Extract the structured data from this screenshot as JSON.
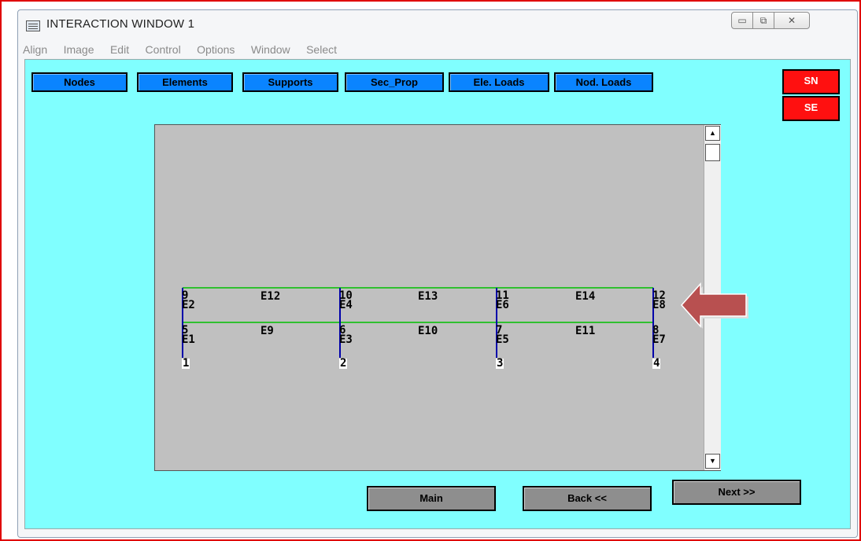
{
  "window": {
    "title": "INTERACTION WINDOW 1",
    "controls": {
      "minimize": "▭",
      "maximize": "⧉",
      "close": "✕"
    }
  },
  "menu": [
    "Align",
    "Image",
    "Edit",
    "Control",
    "Options",
    "Window",
    "Select"
  ],
  "toolbar": [
    "Nodes",
    "Elements",
    "Supports",
    "Sec_Prop",
    "Ele. Loads",
    "Nod. Loads"
  ],
  "side_buttons": [
    "SN",
    "SE"
  ],
  "model": {
    "nodes_bottom": [
      "1",
      "2",
      "3",
      "4"
    ],
    "nodes_mid": [
      "5",
      "6",
      "7",
      "8"
    ],
    "nodes_top": [
      "9",
      "10",
      "11",
      "12"
    ],
    "columns_lower": [
      "E1",
      "E3",
      "E5",
      "E7"
    ],
    "columns_upper": [
      "E2",
      "E4",
      "E6",
      "E8"
    ],
    "beams_mid": [
      "E9",
      "E10",
      "E11"
    ],
    "beams_top": [
      "E12",
      "E13",
      "E14"
    ]
  },
  "nav_buttons": {
    "main": "Main",
    "back": "Back <<",
    "next": "Next >>"
  },
  "colors": {
    "client_bg": "#80ffff",
    "toolbar_btn": "#0a84ff",
    "side_btn": "#ff1010",
    "canvas_bg": "#c0c0c0",
    "column_line": "#0000aa",
    "beam_line": "#00c000",
    "arrow": "#b85050",
    "outer_frame": "#e00000"
  }
}
